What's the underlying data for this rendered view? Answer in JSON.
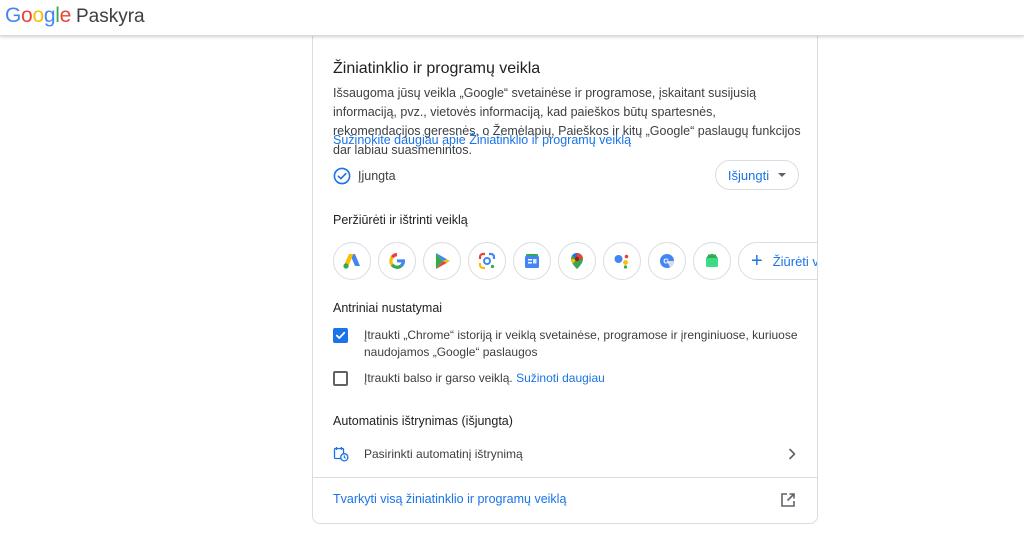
{
  "header": {
    "logo_g1": "G",
    "logo_o1": "o",
    "logo_o2": "o",
    "logo_g2": "g",
    "logo_l": "l",
    "logo_e": "e",
    "product": "Paskyra"
  },
  "activity": {
    "title": "Žiniatinklio ir programų veikla",
    "description": "Išsaugoma jūsų veikla „Google“ svetainėse ir programose, įskaitant susijusią informaciją, pvz., vietovės informaciją, kad paieškos būtų spartesnės, rekomendacijos geresnės, o Žemėlapių, Paieškos ir kitų „Google“ paslaugų funkcijos dar labiau suasmenintos.",
    "learn_more": "Sužinokite daugiau apie Žiniatinklio ir programų veiklą",
    "status": "Įjungta",
    "turn_off": "Išjungti"
  },
  "review": {
    "heading": "Peržiūrėti ir ištrinti veiklą",
    "apps": [
      "google-ads-icon",
      "google-search-icon",
      "google-play-icon",
      "google-lens-icon",
      "google-news-icon",
      "google-maps-icon",
      "google-assistant-icon",
      "google-translate-icon",
      "android-icon"
    ],
    "view_all": "Žiūrėti v"
  },
  "subsettings": {
    "heading": "Antriniai nustatymai",
    "chrome_text": "Įtraukti „Chrome“ istoriją ir veiklą svetainėse, programose ir įrenginiuose, kuriuose naudojamos „Google“ paslaugos",
    "chrome_checked": true,
    "audio_text": "Įtraukti balso ir garso veiklą.",
    "audio_link": "Sužinoti daugiau",
    "audio_checked": false
  },
  "autodelete": {
    "heading": "Automatinis ištrynimas (išjungta)",
    "option": "Pasirinkti automatinį ištrynimą"
  },
  "footer": {
    "manage": "Tvarkyti visą žiniatinklio ir programų veiklą"
  },
  "colors": {
    "accent": "#1a73e8",
    "border": "#dadce0",
    "text": "#202124",
    "secondary": "#3c4043",
    "google_blue": "#4285F4",
    "google_red": "#EA4335",
    "google_yellow": "#FBBC05",
    "google_green": "#34A853"
  }
}
